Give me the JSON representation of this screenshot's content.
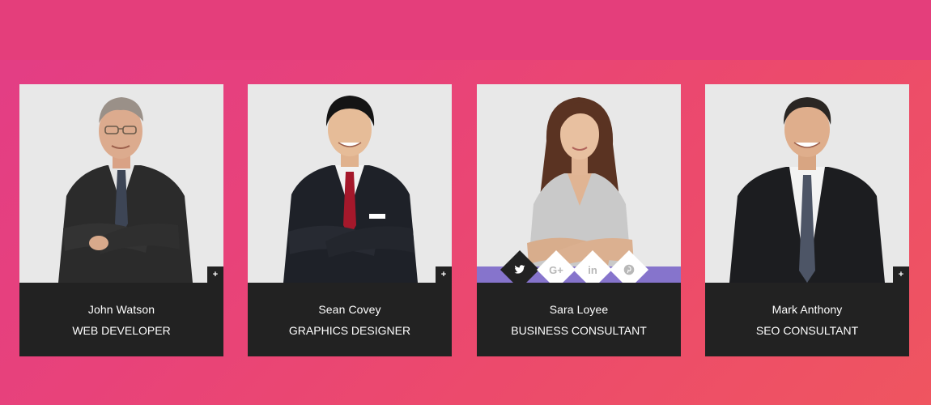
{
  "colors": {
    "background_start": "#e23d86",
    "background_end": "#ef5560",
    "card_dark": "#222222",
    "photo_bg": "#e8e8e8",
    "social_strip": "#8674cc"
  },
  "team": [
    {
      "name": "John Watson",
      "role": "WEB DEVELOPER",
      "expand_label": "+"
    },
    {
      "name": "Sean Covey",
      "role": "GRAPHICS DESIGNER",
      "expand_label": "+"
    },
    {
      "name": "Sara Loyee",
      "role": "BUSINESS CONSULTANT",
      "social": [
        {
          "icon": "twitter-icon"
        },
        {
          "icon": "google-plus-icon",
          "label": "G+"
        },
        {
          "icon": "linkedin-icon",
          "label": "in"
        },
        {
          "icon": "pinterest-icon"
        }
      ]
    },
    {
      "name": "Mark Anthony",
      "role": "SEO CONSULTANT",
      "expand_label": "+"
    }
  ]
}
